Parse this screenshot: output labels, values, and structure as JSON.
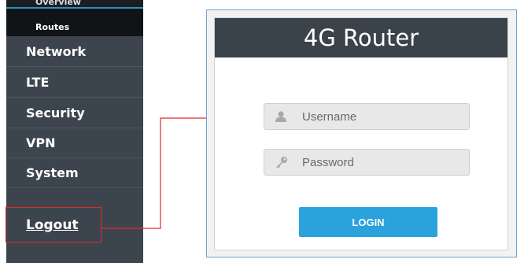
{
  "sidebar": {
    "sub_items": [
      "Overview",
      "Routes"
    ],
    "items": [
      "Network",
      "LTE",
      "Security",
      "VPN",
      "System"
    ],
    "logout": "Logout"
  },
  "login": {
    "title": "4G Router",
    "username_placeholder": "Username",
    "password_placeholder": "Password",
    "button": "LOGIN"
  },
  "icons": {
    "username": "user-icon",
    "password": "key-icon"
  },
  "colors": {
    "sidebar_bg": "#3c454d",
    "header_bg": "#3a424a",
    "button_bg": "#2aa3dd",
    "highlight": "#e8262c",
    "frame_border": "#6fa2cf"
  }
}
